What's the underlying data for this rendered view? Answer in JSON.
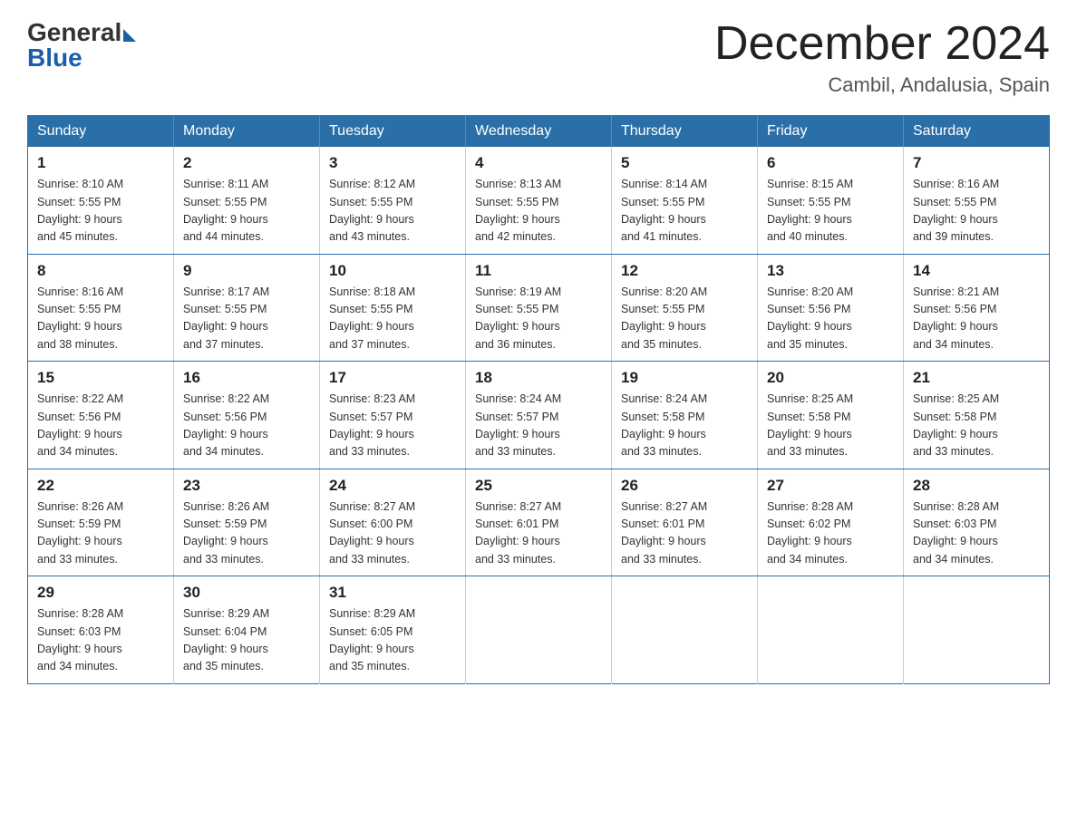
{
  "logo": {
    "general": "General",
    "blue": "Blue"
  },
  "header": {
    "month": "December 2024",
    "location": "Cambil, Andalusia, Spain"
  },
  "days_of_week": [
    "Sunday",
    "Monday",
    "Tuesday",
    "Wednesday",
    "Thursday",
    "Friday",
    "Saturday"
  ],
  "weeks": [
    [
      {
        "num": "1",
        "sunrise": "8:10 AM",
        "sunset": "5:55 PM",
        "daylight": "9 hours and 45 minutes."
      },
      {
        "num": "2",
        "sunrise": "8:11 AM",
        "sunset": "5:55 PM",
        "daylight": "9 hours and 44 minutes."
      },
      {
        "num": "3",
        "sunrise": "8:12 AM",
        "sunset": "5:55 PM",
        "daylight": "9 hours and 43 minutes."
      },
      {
        "num": "4",
        "sunrise": "8:13 AM",
        "sunset": "5:55 PM",
        "daylight": "9 hours and 42 minutes."
      },
      {
        "num": "5",
        "sunrise": "8:14 AM",
        "sunset": "5:55 PM",
        "daylight": "9 hours and 41 minutes."
      },
      {
        "num": "6",
        "sunrise": "8:15 AM",
        "sunset": "5:55 PM",
        "daylight": "9 hours and 40 minutes."
      },
      {
        "num": "7",
        "sunrise": "8:16 AM",
        "sunset": "5:55 PM",
        "daylight": "9 hours and 39 minutes."
      }
    ],
    [
      {
        "num": "8",
        "sunrise": "8:16 AM",
        "sunset": "5:55 PM",
        "daylight": "9 hours and 38 minutes."
      },
      {
        "num": "9",
        "sunrise": "8:17 AM",
        "sunset": "5:55 PM",
        "daylight": "9 hours and 37 minutes."
      },
      {
        "num": "10",
        "sunrise": "8:18 AM",
        "sunset": "5:55 PM",
        "daylight": "9 hours and 37 minutes."
      },
      {
        "num": "11",
        "sunrise": "8:19 AM",
        "sunset": "5:55 PM",
        "daylight": "9 hours and 36 minutes."
      },
      {
        "num": "12",
        "sunrise": "8:20 AM",
        "sunset": "5:55 PM",
        "daylight": "9 hours and 35 minutes."
      },
      {
        "num": "13",
        "sunrise": "8:20 AM",
        "sunset": "5:56 PM",
        "daylight": "9 hours and 35 minutes."
      },
      {
        "num": "14",
        "sunrise": "8:21 AM",
        "sunset": "5:56 PM",
        "daylight": "9 hours and 34 minutes."
      }
    ],
    [
      {
        "num": "15",
        "sunrise": "8:22 AM",
        "sunset": "5:56 PM",
        "daylight": "9 hours and 34 minutes."
      },
      {
        "num": "16",
        "sunrise": "8:22 AM",
        "sunset": "5:56 PM",
        "daylight": "9 hours and 34 minutes."
      },
      {
        "num": "17",
        "sunrise": "8:23 AM",
        "sunset": "5:57 PM",
        "daylight": "9 hours and 33 minutes."
      },
      {
        "num": "18",
        "sunrise": "8:24 AM",
        "sunset": "5:57 PM",
        "daylight": "9 hours and 33 minutes."
      },
      {
        "num": "19",
        "sunrise": "8:24 AM",
        "sunset": "5:58 PM",
        "daylight": "9 hours and 33 minutes."
      },
      {
        "num": "20",
        "sunrise": "8:25 AM",
        "sunset": "5:58 PM",
        "daylight": "9 hours and 33 minutes."
      },
      {
        "num": "21",
        "sunrise": "8:25 AM",
        "sunset": "5:58 PM",
        "daylight": "9 hours and 33 minutes."
      }
    ],
    [
      {
        "num": "22",
        "sunrise": "8:26 AM",
        "sunset": "5:59 PM",
        "daylight": "9 hours and 33 minutes."
      },
      {
        "num": "23",
        "sunrise": "8:26 AM",
        "sunset": "5:59 PM",
        "daylight": "9 hours and 33 minutes."
      },
      {
        "num": "24",
        "sunrise": "8:27 AM",
        "sunset": "6:00 PM",
        "daylight": "9 hours and 33 minutes."
      },
      {
        "num": "25",
        "sunrise": "8:27 AM",
        "sunset": "6:01 PM",
        "daylight": "9 hours and 33 minutes."
      },
      {
        "num": "26",
        "sunrise": "8:27 AM",
        "sunset": "6:01 PM",
        "daylight": "9 hours and 33 minutes."
      },
      {
        "num": "27",
        "sunrise": "8:28 AM",
        "sunset": "6:02 PM",
        "daylight": "9 hours and 34 minutes."
      },
      {
        "num": "28",
        "sunrise": "8:28 AM",
        "sunset": "6:03 PM",
        "daylight": "9 hours and 34 minutes."
      }
    ],
    [
      {
        "num": "29",
        "sunrise": "8:28 AM",
        "sunset": "6:03 PM",
        "daylight": "9 hours and 34 minutes."
      },
      {
        "num": "30",
        "sunrise": "8:29 AM",
        "sunset": "6:04 PM",
        "daylight": "9 hours and 35 minutes."
      },
      {
        "num": "31",
        "sunrise": "8:29 AM",
        "sunset": "6:05 PM",
        "daylight": "9 hours and 35 minutes."
      },
      null,
      null,
      null,
      null
    ]
  ],
  "labels": {
    "sunrise": "Sunrise:",
    "sunset": "Sunset:",
    "daylight": "Daylight:"
  }
}
